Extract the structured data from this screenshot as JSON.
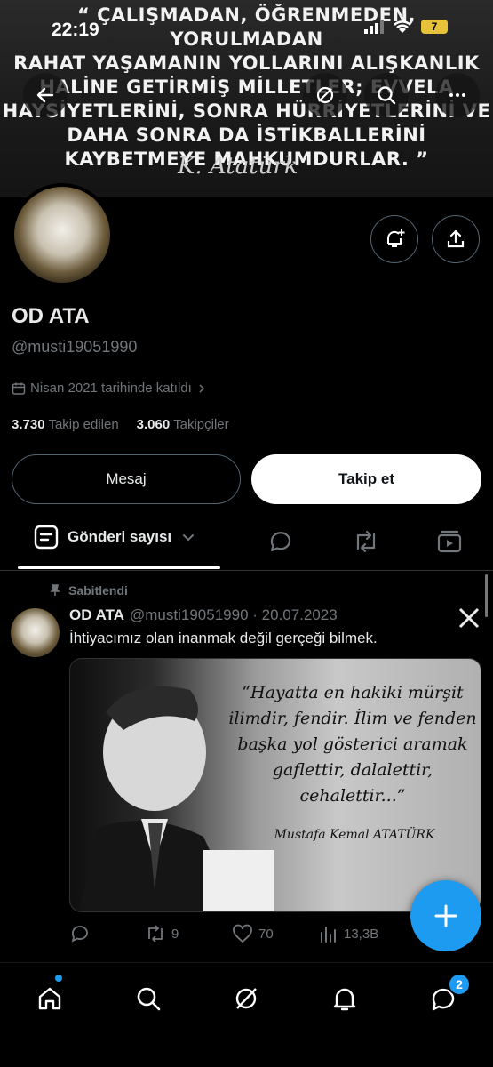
{
  "status_bar": {
    "time": "22:19",
    "battery": "7"
  },
  "banner": {
    "quote_lines": [
      "“ ÇALIŞMADAN, ÖĞRENMEDEN, YORULMADAN",
      "RAHAT YAŞAMANIN YOLLARINI ALIŞKANLIK",
      "HALİNE GETİRMİŞ MİLLETLER; EVVELA",
      "HAYSİYETLERİNİ, SONRA HÜRRİYETLERİNİ VE",
      "DAHA SONRA DA İSTİKBALLERİNİ",
      "KAYBETMEYE MAHKUMDURLAR. ”"
    ],
    "signature": "K. Atatürk"
  },
  "profile": {
    "name": "OD ATA",
    "handle": "@musti19051990",
    "joined": "Nisan 2021 tarihinde katıldı",
    "following_count": "3.730",
    "following_label": "Takip edilen",
    "followers_count": "3.060",
    "followers_label": "Takipçiler",
    "message_button": "Mesaj",
    "follow_button": "Takip et"
  },
  "tabs": {
    "active_label": "Gönderi sayısı"
  },
  "post": {
    "pinned_label": "Sabitlendi",
    "author": "OD ATA",
    "meta": "@musti19051990 · 20.07.2023",
    "text": "İhtiyacımız olan inanmak değil gerçeği bilmek.",
    "image_quote": "“Hayatta en hakiki mürşit ilimdir, fendir. İlim ve fenden başka yol gösterici aramak gaflettir, dalalettir, cehalettir...”",
    "image_author": "Mustafa Kemal ATATÜRK",
    "retweets": "9",
    "likes": "70",
    "views": "13,3B"
  },
  "bottom_nav": {
    "messages_badge": "2"
  },
  "colors": {
    "accent": "#1d9bf0",
    "background": "#000000",
    "muted": "#71767b"
  }
}
